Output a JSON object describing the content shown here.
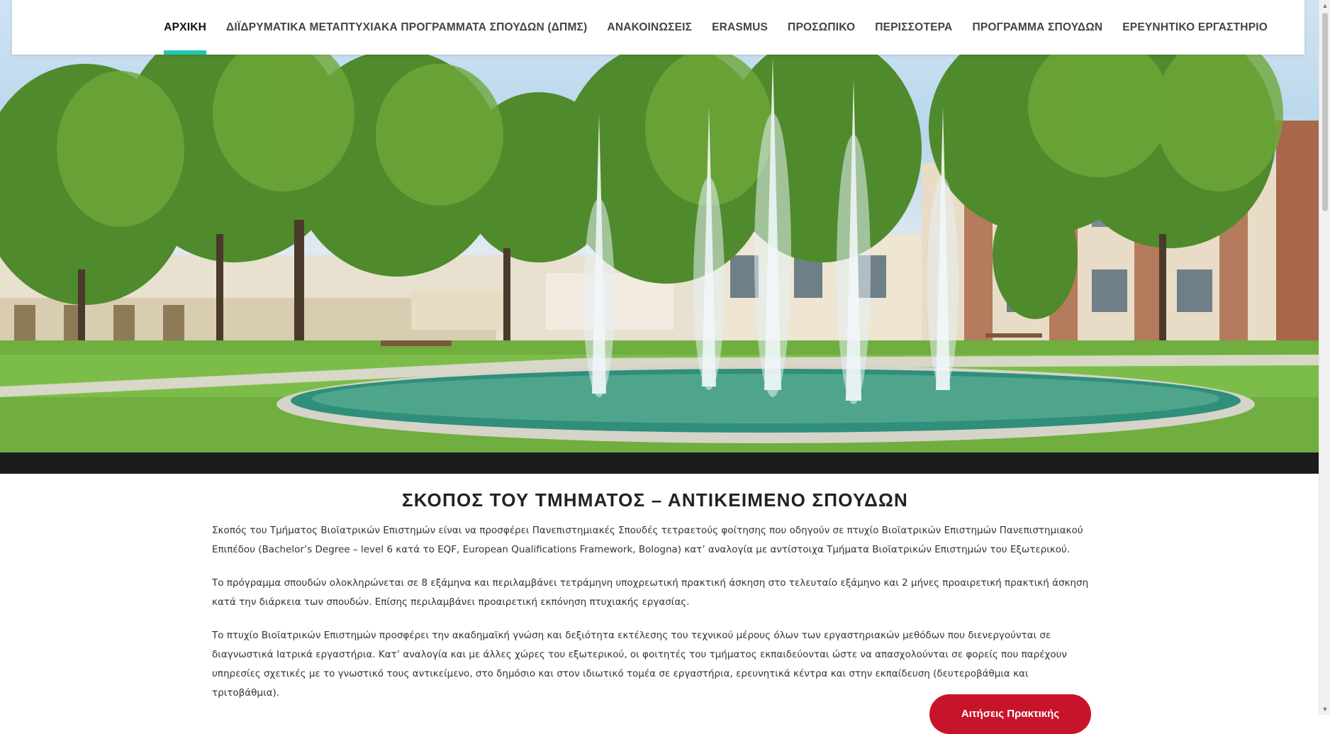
{
  "nav": {
    "items": [
      {
        "label": "ΑΡΧΙΚΗ",
        "active": true
      },
      {
        "label": "ΔΙΪΔΡΥΜΑΤΙΚΑ ΜΕΤΑΠΤΥΧΙΑΚΑ ΠΡΟΓΡΑΜΜΑΤΑ ΣΠΟΥΔΩΝ (ΔΠΜΣ)",
        "active": false
      },
      {
        "label": "ΑΝΑΚΟΙΝΩΣΕΙΣ",
        "active": false
      },
      {
        "label": "ERASMUS",
        "active": false
      },
      {
        "label": "ΠΡΟΣΩΠΙΚΟ",
        "active": false
      },
      {
        "label": "ΠΕΡΙΣΣΟΤΕΡΑ",
        "active": false
      },
      {
        "label": "ΠΡΟΓΡΑΜΜΑ ΣΠΟΥΔΩΝ",
        "active": false
      },
      {
        "label": "ΕΡΕΥΝΗΤΙΚΟ ΕΡΓΑΣΤΗΡΙΟ",
        "active": false
      }
    ]
  },
  "hero": {
    "image": "campus-fountain-photo"
  },
  "main": {
    "title": "ΣΚΟΠΟΣ ΤΟΥ ΤΜΗΜΑΤΟΣ – ΑΝΤΙΚΕΙΜΕΝΟ ΣΠΟΥΔΩΝ",
    "paragraphs": [
      "Σκοπός του Τμήματος Βιοϊατρικών Επιστημών είναι να προσφέρει Πανεπιστημιακές Σπουδές τετραετούς φοίτησης που οδηγούν σε πτυχίο Βιοϊατρικών Επιστημών Πανεπιστημιακού Επιπέδου (Bachelor’s Degree – level 6 κατά το EQF, European Qualifications Framework, Bologna) κατ’ αναλογία με αντίστοιχα Τμήματα Βιοϊατρικών Επιστημών του Εξωτερικού.",
      "Το πρόγραμμα σπουδών ολοκληρώνεται σε 8 εξάμηνα και περιλαμβάνει τετράμηνη υποχρεωτική πρακτική άσκηση στο τελευταίο εξάμηνο και 2 μήνες προαιρετική πρακτική άσκηση κατά την διάρκεια των σπουδών. Επίσης περιλαμβάνει προαιρετική εκπόνηση πτυχιακής εργασίας.",
      "Το πτυχίο Βιοϊατρικών Επιστημών προσφέρει την ακαδημαϊκή γνώση και δεξιότητα εκτέλεσης του τεχνικού μέρους όλων των εργαστηριακών μεθόδων που διενεργούνται σε διαγνωστικά Ιατρικά εργαστήρια. Κατ’ αναλογία και με άλλες χώρες του εξωτερικού, οι φοιτητές του τμήματος εκπαιδεύονται ώστε να απασχολούνται σε φορείς που παρέχουν υπηρεσίες σχετικές με το γνωστικό τους αντικείμενο, στο δημόσιο και στον ιδιωτικό τομέα σε εργαστήρια, ερευνητικά κέντρα και στην εκπαίδευση (δευτεροβάθμια και τριτοβάθμια)."
    ],
    "cta_label": "Αιτήσεις Πρακτικής"
  },
  "colors": {
    "accent": "#20c6b6",
    "cta": "#c8142a"
  }
}
